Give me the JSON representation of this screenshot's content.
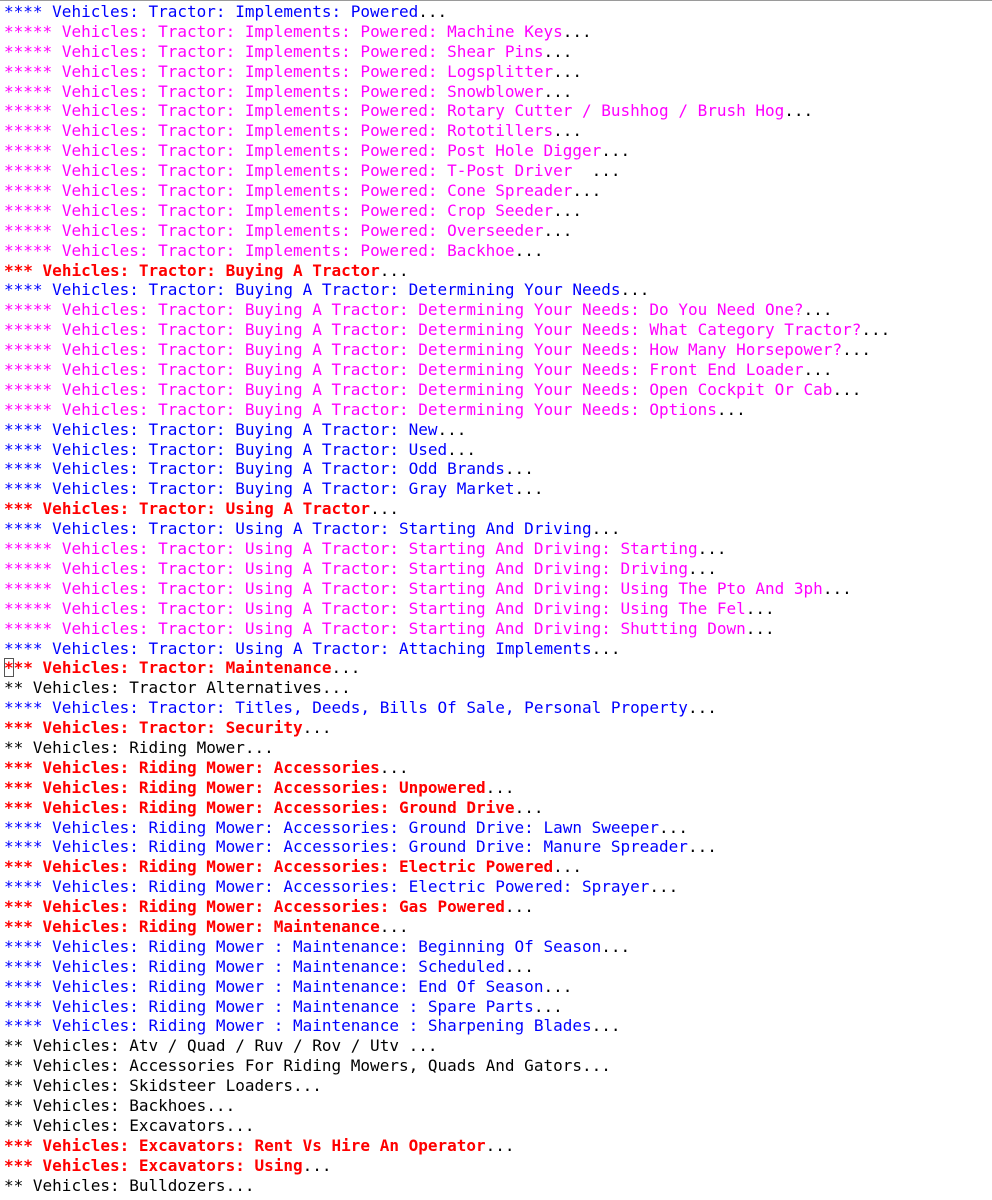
{
  "colors": {
    "level_2": "#000000",
    "level_3": "#ff0000",
    "level_4": "#0000ff",
    "level_5": "#ff00ff",
    "ellipsis": "#000000"
  },
  "outline": [
    {
      "stars": "****",
      "heading": "Vehicles: Tractor: Implements: Powered",
      "ellipsis": "..."
    },
    {
      "stars": "*****",
      "heading": "Vehicles: Tractor: Implements: Powered: Machine Keys",
      "ellipsis": "..."
    },
    {
      "stars": "*****",
      "heading": "Vehicles: Tractor: Implements: Powered: Shear Pins",
      "ellipsis": "..."
    },
    {
      "stars": "*****",
      "heading": "Vehicles: Tractor: Implements: Powered: Logsplitter",
      "ellipsis": "..."
    },
    {
      "stars": "*****",
      "heading": "Vehicles: Tractor: Implements: Powered: Snowblower",
      "ellipsis": "..."
    },
    {
      "stars": "*****",
      "heading": "Vehicles: Tractor: Implements: Powered: Rotary Cutter / Bushhog / Brush Hog",
      "ellipsis": "..."
    },
    {
      "stars": "*****",
      "heading": "Vehicles: Tractor: Implements: Powered: Rototillers",
      "ellipsis": "..."
    },
    {
      "stars": "*****",
      "heading": "Vehicles: Tractor: Implements: Powered: Post Hole Digger",
      "ellipsis": "..."
    },
    {
      "stars": "*****",
      "heading": "Vehicles: Tractor: Implements: Powered: T-Post Driver  ",
      "ellipsis": "..."
    },
    {
      "stars": "*****",
      "heading": "Vehicles: Tractor: Implements: Powered: Cone Spreader",
      "ellipsis": "..."
    },
    {
      "stars": "*****",
      "heading": "Vehicles: Tractor: Implements: Powered: Crop Seeder",
      "ellipsis": "..."
    },
    {
      "stars": "*****",
      "heading": "Vehicles: Tractor: Implements: Powered: Overseeder",
      "ellipsis": "..."
    },
    {
      "stars": "*****",
      "heading": "Vehicles: Tractor: Implements: Powered: Backhoe",
      "ellipsis": "..."
    },
    {
      "stars": "***",
      "heading": "Vehicles: Tractor: Buying A Tractor",
      "ellipsis": "..."
    },
    {
      "stars": "****",
      "heading": "Vehicles: Tractor: Buying A Tractor: Determining Your Needs",
      "ellipsis": "..."
    },
    {
      "stars": "*****",
      "heading": "Vehicles: Tractor: Buying A Tractor: Determining Your Needs: Do You Need One?",
      "ellipsis": "..."
    },
    {
      "stars": "*****",
      "heading": "Vehicles: Tractor: Buying A Tractor: Determining Your Needs: What Category Tractor?",
      "ellipsis": "..."
    },
    {
      "stars": "*****",
      "heading": "Vehicles: Tractor: Buying A Tractor: Determining Your Needs: How Many Horsepower?",
      "ellipsis": "..."
    },
    {
      "stars": "*****",
      "heading": "Vehicles: Tractor: Buying A Tractor: Determining Your Needs: Front End Loader",
      "ellipsis": "..."
    },
    {
      "stars": "*****",
      "heading": "Vehicles: Tractor: Buying A Tractor: Determining Your Needs: Open Cockpit Or Cab",
      "ellipsis": "..."
    },
    {
      "stars": "*****",
      "heading": "Vehicles: Tractor: Buying A Tractor: Determining Your Needs: Options",
      "ellipsis": "..."
    },
    {
      "stars": "****",
      "heading": "Vehicles: Tractor: Buying A Tractor: New",
      "ellipsis": "..."
    },
    {
      "stars": "****",
      "heading": "Vehicles: Tractor: Buying A Tractor: Used",
      "ellipsis": "..."
    },
    {
      "stars": "****",
      "heading": "Vehicles: Tractor: Buying A Tractor: Odd Brands",
      "ellipsis": "..."
    },
    {
      "stars": "****",
      "heading": "Vehicles: Tractor: Buying A Tractor: Gray Market",
      "ellipsis": "..."
    },
    {
      "stars": "***",
      "heading": "Vehicles: Tractor: Using A Tractor",
      "ellipsis": "..."
    },
    {
      "stars": "****",
      "heading": "Vehicles: Tractor: Using A Tractor: Starting And Driving",
      "ellipsis": "..."
    },
    {
      "stars": "*****",
      "heading": "Vehicles: Tractor: Using A Tractor: Starting And Driving: Starting",
      "ellipsis": "..."
    },
    {
      "stars": "*****",
      "heading": "Vehicles: Tractor: Using A Tractor: Starting And Driving: Driving",
      "ellipsis": "..."
    },
    {
      "stars": "*****",
      "heading": "Vehicles: Tractor: Using A Tractor: Starting And Driving: Using The Pto And 3ph",
      "ellipsis": "..."
    },
    {
      "stars": "*****",
      "heading": "Vehicles: Tractor: Using A Tractor: Starting And Driving: Using The Fel",
      "ellipsis": "..."
    },
    {
      "stars": "*****",
      "heading": "Vehicles: Tractor: Using A Tractor: Starting And Driving: Shutting Down",
      "ellipsis": "..."
    },
    {
      "stars": "****",
      "heading": "Vehicles: Tractor: Using A Tractor: Attaching Implements",
      "ellipsis": "..."
    },
    {
      "stars": "***",
      "heading": "Vehicles: Tractor: Maintenance",
      "ellipsis": "...",
      "cursor": true
    },
    {
      "stars": "**",
      "heading": "Vehicles: Tractor Alternatives",
      "ellipsis": "..."
    },
    {
      "stars": "****",
      "heading": "Vehicles: Tractor: Titles, Deeds, Bills Of Sale, Personal Property",
      "ellipsis": "..."
    },
    {
      "stars": "***",
      "heading": "Vehicles: Tractor: Security",
      "ellipsis": "..."
    },
    {
      "stars": "**",
      "heading": "Vehicles: Riding Mower",
      "ellipsis": "..."
    },
    {
      "stars": "***",
      "heading": "Vehicles: Riding Mower: Accessories",
      "ellipsis": "..."
    },
    {
      "stars": "***",
      "heading": "Vehicles: Riding Mower: Accessories: Unpowered",
      "ellipsis": "..."
    },
    {
      "stars": "***",
      "heading": "Vehicles: Riding Mower: Accessories: Ground Drive",
      "ellipsis": "..."
    },
    {
      "stars": "****",
      "heading": "Vehicles: Riding Mower: Accessories: Ground Drive: Lawn Sweeper",
      "ellipsis": "..."
    },
    {
      "stars": "****",
      "heading": "Vehicles: Riding Mower: Accessories: Ground Drive: Manure Spreader",
      "ellipsis": "..."
    },
    {
      "stars": "***",
      "heading": "Vehicles: Riding Mower: Accessories: Electric Powered",
      "ellipsis": "..."
    },
    {
      "stars": "****",
      "heading": "Vehicles: Riding Mower: Accessories: Electric Powered: Sprayer",
      "ellipsis": "..."
    },
    {
      "stars": "***",
      "heading": "Vehicles: Riding Mower: Accessories: Gas Powered",
      "ellipsis": "..."
    },
    {
      "stars": "***",
      "heading": "Vehicles: Riding Mower: Maintenance",
      "ellipsis": "..."
    },
    {
      "stars": "****",
      "heading": "Vehicles: Riding Mower : Maintenance: Beginning Of Season",
      "ellipsis": "..."
    },
    {
      "stars": "****",
      "heading": "Vehicles: Riding Mower : Maintenance: Scheduled",
      "ellipsis": "..."
    },
    {
      "stars": "****",
      "heading": "Vehicles: Riding Mower : Maintenance: End Of Season",
      "ellipsis": "..."
    },
    {
      "stars": "****",
      "heading": "Vehicles: Riding Mower : Maintenance : Spare Parts",
      "ellipsis": "..."
    },
    {
      "stars": "****",
      "heading": "Vehicles: Riding Mower : Maintenance : Sharpening Blades",
      "ellipsis": "..."
    },
    {
      "stars": "**",
      "heading": "Vehicles: Atv / Quad / Ruv / Rov / Utv ",
      "ellipsis": "..."
    },
    {
      "stars": "**",
      "heading": "Vehicles: Accessories For Riding Mowers, Quads And Gators",
      "ellipsis": "..."
    },
    {
      "stars": "**",
      "heading": "Vehicles: Skidsteer Loaders",
      "ellipsis": "..."
    },
    {
      "stars": "**",
      "heading": "Vehicles: Backhoes",
      "ellipsis": "..."
    },
    {
      "stars": "**",
      "heading": "Vehicles: Excavators",
      "ellipsis": "..."
    },
    {
      "stars": "***",
      "heading": "Vehicles: Excavators: Rent Vs Hire An Operator",
      "ellipsis": "..."
    },
    {
      "stars": "***",
      "heading": "Vehicles: Excavators: Using",
      "ellipsis": "..."
    },
    {
      "stars": "**",
      "heading": "Vehicles: Bulldozers",
      "ellipsis": "..."
    }
  ]
}
